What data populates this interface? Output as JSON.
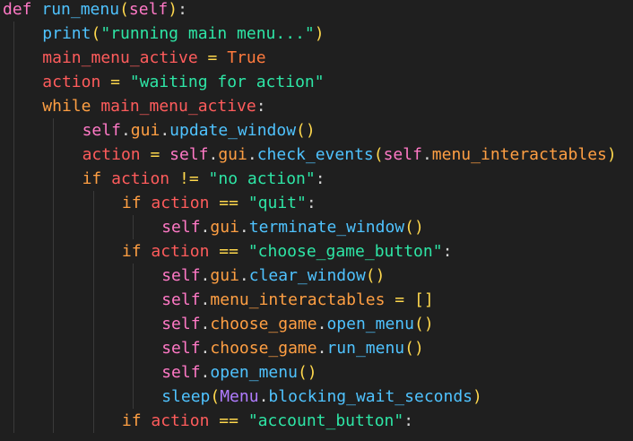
{
  "colors": {
    "background": "#1f1f1f",
    "keyword": "#ff79c6",
    "control": "#ff9f43",
    "function": "#4fc3ff",
    "string": "#2ee6a6",
    "variable": "#ff5c5c",
    "boolean": "#ff7a3d",
    "operator": "#ffd84d",
    "class": "#b07cff",
    "punctuation": "#d4d4d4"
  },
  "lines": [
    {
      "indent": 0,
      "tokens": [
        {
          "t": "def",
          "k": "kw"
        },
        {
          "t": " ",
          "k": "plain"
        },
        {
          "t": "run_menu",
          "k": "fn"
        },
        {
          "t": "(",
          "k": "paren"
        },
        {
          "t": "self",
          "k": "self"
        },
        {
          "t": ")",
          "k": "paren"
        },
        {
          "t": ":",
          "k": "colon"
        }
      ]
    },
    {
      "indent": 1,
      "tokens": [
        {
          "t": "print",
          "k": "fn"
        },
        {
          "t": "(",
          "k": "paren"
        },
        {
          "t": "\"running main menu...\"",
          "k": "str"
        },
        {
          "t": ")",
          "k": "paren"
        }
      ]
    },
    {
      "indent": 1,
      "tokens": [
        {
          "t": "main_menu_active",
          "k": "var"
        },
        {
          "t": " = ",
          "k": "op"
        },
        {
          "t": "True",
          "k": "bool"
        }
      ]
    },
    {
      "indent": 1,
      "tokens": [
        {
          "t": "action",
          "k": "var"
        },
        {
          "t": " = ",
          "k": "op"
        },
        {
          "t": "\"waiting for action\"",
          "k": "str"
        }
      ]
    },
    {
      "indent": 1,
      "tokens": [
        {
          "t": "while",
          "k": "ctl"
        },
        {
          "t": " ",
          "k": "plain"
        },
        {
          "t": "main_menu_active",
          "k": "var"
        },
        {
          "t": ":",
          "k": "colon"
        }
      ]
    },
    {
      "indent": 2,
      "tokens": [
        {
          "t": "self",
          "k": "self"
        },
        {
          "t": ".",
          "k": "dot"
        },
        {
          "t": "gui",
          "k": "attr"
        },
        {
          "t": ".",
          "k": "dot"
        },
        {
          "t": "update_window",
          "k": "fn"
        },
        {
          "t": "()",
          "k": "paren"
        }
      ]
    },
    {
      "indent": 2,
      "tokens": [
        {
          "t": "action",
          "k": "var"
        },
        {
          "t": " = ",
          "k": "op"
        },
        {
          "t": "self",
          "k": "self"
        },
        {
          "t": ".",
          "k": "dot"
        },
        {
          "t": "gui",
          "k": "attr"
        },
        {
          "t": ".",
          "k": "dot"
        },
        {
          "t": "check_events",
          "k": "fn"
        },
        {
          "t": "(",
          "k": "paren"
        },
        {
          "t": "self",
          "k": "self"
        },
        {
          "t": ".",
          "k": "dot"
        },
        {
          "t": "menu_interactables",
          "k": "attr"
        },
        {
          "t": ")",
          "k": "paren"
        }
      ]
    },
    {
      "indent": 2,
      "tokens": [
        {
          "t": "if",
          "k": "ctl"
        },
        {
          "t": " ",
          "k": "plain"
        },
        {
          "t": "action",
          "k": "var"
        },
        {
          "t": " != ",
          "k": "op"
        },
        {
          "t": "\"no action\"",
          "k": "str"
        },
        {
          "t": ":",
          "k": "colon"
        }
      ]
    },
    {
      "indent": 3,
      "tokens": [
        {
          "t": "if",
          "k": "ctl"
        },
        {
          "t": " ",
          "k": "plain"
        },
        {
          "t": "action",
          "k": "var"
        },
        {
          "t": " == ",
          "k": "op"
        },
        {
          "t": "\"quit\"",
          "k": "str"
        },
        {
          "t": ":",
          "k": "colon"
        }
      ]
    },
    {
      "indent": 4,
      "tokens": [
        {
          "t": "self",
          "k": "self"
        },
        {
          "t": ".",
          "k": "dot"
        },
        {
          "t": "gui",
          "k": "attr"
        },
        {
          "t": ".",
          "k": "dot"
        },
        {
          "t": "terminate_window",
          "k": "fn"
        },
        {
          "t": "()",
          "k": "paren"
        }
      ]
    },
    {
      "indent": 3,
      "tokens": [
        {
          "t": "if",
          "k": "ctl"
        },
        {
          "t": " ",
          "k": "plain"
        },
        {
          "t": "action",
          "k": "var"
        },
        {
          "t": " == ",
          "k": "op"
        },
        {
          "t": "\"choose_game_button\"",
          "k": "str"
        },
        {
          "t": ":",
          "k": "colon"
        }
      ]
    },
    {
      "indent": 4,
      "tokens": [
        {
          "t": "self",
          "k": "self"
        },
        {
          "t": ".",
          "k": "dot"
        },
        {
          "t": "gui",
          "k": "attr"
        },
        {
          "t": ".",
          "k": "dot"
        },
        {
          "t": "clear_window",
          "k": "fn"
        },
        {
          "t": "()",
          "k": "paren"
        }
      ]
    },
    {
      "indent": 4,
      "tokens": [
        {
          "t": "self",
          "k": "self"
        },
        {
          "t": ".",
          "k": "dot"
        },
        {
          "t": "menu_interactables",
          "k": "attr"
        },
        {
          "t": " = ",
          "k": "op"
        },
        {
          "t": "[]",
          "k": "paren"
        }
      ]
    },
    {
      "indent": 4,
      "tokens": [
        {
          "t": "self",
          "k": "self"
        },
        {
          "t": ".",
          "k": "dot"
        },
        {
          "t": "choose_game",
          "k": "attr"
        },
        {
          "t": ".",
          "k": "dot"
        },
        {
          "t": "open_menu",
          "k": "fn"
        },
        {
          "t": "()",
          "k": "paren"
        }
      ]
    },
    {
      "indent": 4,
      "tokens": [
        {
          "t": "self",
          "k": "self"
        },
        {
          "t": ".",
          "k": "dot"
        },
        {
          "t": "choose_game",
          "k": "attr"
        },
        {
          "t": ".",
          "k": "dot"
        },
        {
          "t": "run_menu",
          "k": "fn"
        },
        {
          "t": "()",
          "k": "paren"
        }
      ]
    },
    {
      "indent": 4,
      "tokens": [
        {
          "t": "self",
          "k": "self"
        },
        {
          "t": ".",
          "k": "dot"
        },
        {
          "t": "open_menu",
          "k": "fn"
        },
        {
          "t": "()",
          "k": "paren"
        }
      ]
    },
    {
      "indent": 4,
      "tokens": [
        {
          "t": "sleep",
          "k": "fn"
        },
        {
          "t": "(",
          "k": "paren"
        },
        {
          "t": "Menu",
          "k": "class"
        },
        {
          "t": ".",
          "k": "dot"
        },
        {
          "t": "blocking_wait_seconds",
          "k": "fn"
        },
        {
          "t": ")",
          "k": "paren"
        }
      ]
    },
    {
      "indent": 3,
      "tokens": [
        {
          "t": "if",
          "k": "ctl"
        },
        {
          "t": " ",
          "k": "plain"
        },
        {
          "t": "action",
          "k": "var"
        },
        {
          "t": " == ",
          "k": "op"
        },
        {
          "t": "\"account_button\"",
          "k": "str"
        },
        {
          "t": ":",
          "k": "colon"
        }
      ]
    }
  ]
}
